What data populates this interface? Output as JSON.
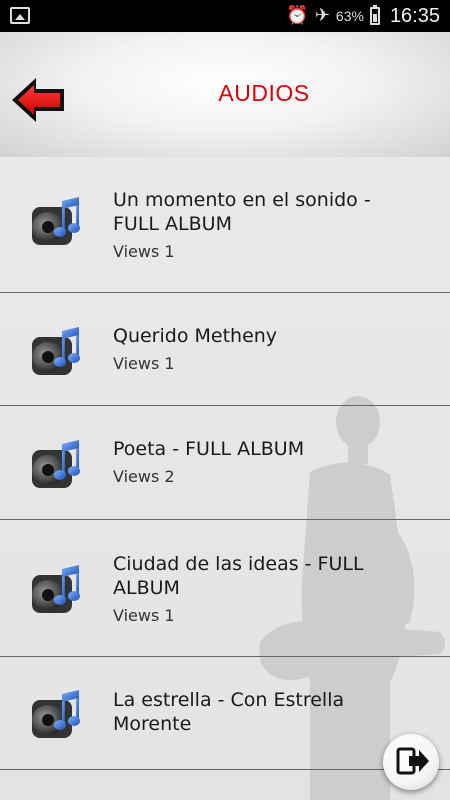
{
  "status_bar": {
    "battery_percent": "63%",
    "time": "16:35",
    "icons": [
      "image-icon",
      "alarm-icon",
      "airplane-icon",
      "battery-icon"
    ]
  },
  "header": {
    "title": "AUDIOS",
    "back_icon": "back-arrow-icon"
  },
  "items": [
    {
      "title": "Un momento en el sonido - FULL ALBUM",
      "views": "Views 1"
    },
    {
      "title": "Querido Metheny",
      "views": "Views 1"
    },
    {
      "title": "Poeta - FULL ALBUM",
      "views": "Views 2"
    },
    {
      "title": "Ciudad de las ideas - FULL ALBUM",
      "views": "Views 1"
    },
    {
      "title": "La estrella - Con Estrella Morente",
      "views": ""
    }
  ],
  "fab": {
    "icon": "exit-icon"
  },
  "colors": {
    "title_red": "#e00000",
    "list_bg": "#e6e6e6",
    "divider": "#666666"
  }
}
